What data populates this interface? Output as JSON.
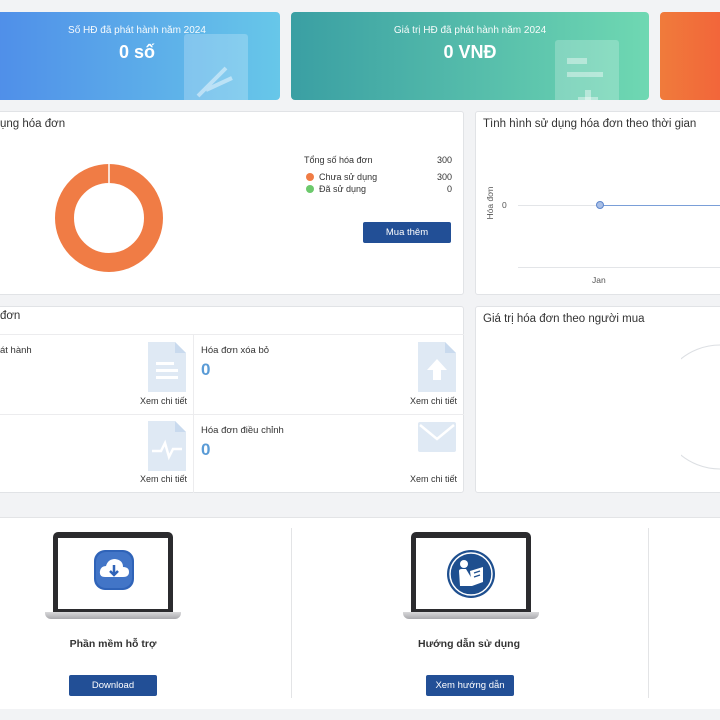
{
  "stats": {
    "issued_count": {
      "label": "Số HĐ đã phát hành năm 2024",
      "value": "0 số"
    },
    "issued_value": {
      "label": "Giá trị HĐ đã phát hành năm 2024",
      "value": "0 VNĐ"
    }
  },
  "usage": {
    "title": "ụng hóa đơn",
    "total_label": "Tổng số hóa đơn",
    "total_value": "300",
    "unused_label": "Chưa sử dụng",
    "unused_value": "300",
    "used_label": "Đã sử dụng",
    "used_value": "0",
    "buy_more": "Mua thêm",
    "colors": {
      "unused": "#f07c45",
      "used": "#6cc96c"
    }
  },
  "timeline": {
    "title": "Tình hình sử dụng hóa đơn theo thời gian",
    "ylabel": "Hóa đơn",
    "ytick": "0",
    "xtick": "Jan"
  },
  "invoices": {
    "title": "đơn",
    "cells": [
      {
        "title": "át hành",
        "value": "",
        "link": "Xem chi tiết"
      },
      {
        "title": "Hóa đơn xóa bỏ",
        "value": "0",
        "link": "Xem chi tiết"
      },
      {
        "title": "",
        "value": "",
        "link": "Xem chi tiết"
      },
      {
        "title": "Hóa đơn điều chỉnh",
        "value": "0",
        "link": "Xem chi tiết"
      }
    ]
  },
  "buyer_chart": {
    "title": "Giá trị hóa đơn theo người mua"
  },
  "support": {
    "software": {
      "title": "Phần mềm hỗ trợ",
      "button": "Download"
    },
    "guide": {
      "title": "Hướng dẫn sử dụng",
      "button": "Xem hướng dẫn"
    }
  },
  "chart_data": [
    {
      "type": "pie",
      "labels": [
        "Chưa sử dụng",
        "Đã sử dụng"
      ],
      "values": [
        300,
        0
      ],
      "colors": [
        "#f07c45",
        "#6cc96c"
      ]
    },
    {
      "type": "line",
      "title": "Tình hình sử dụng hóa đơn theo thời gian",
      "ylabel": "Hóa đơn",
      "x": [
        "Jan"
      ],
      "series": [
        {
          "values": [
            0
          ]
        }
      ]
    }
  ]
}
